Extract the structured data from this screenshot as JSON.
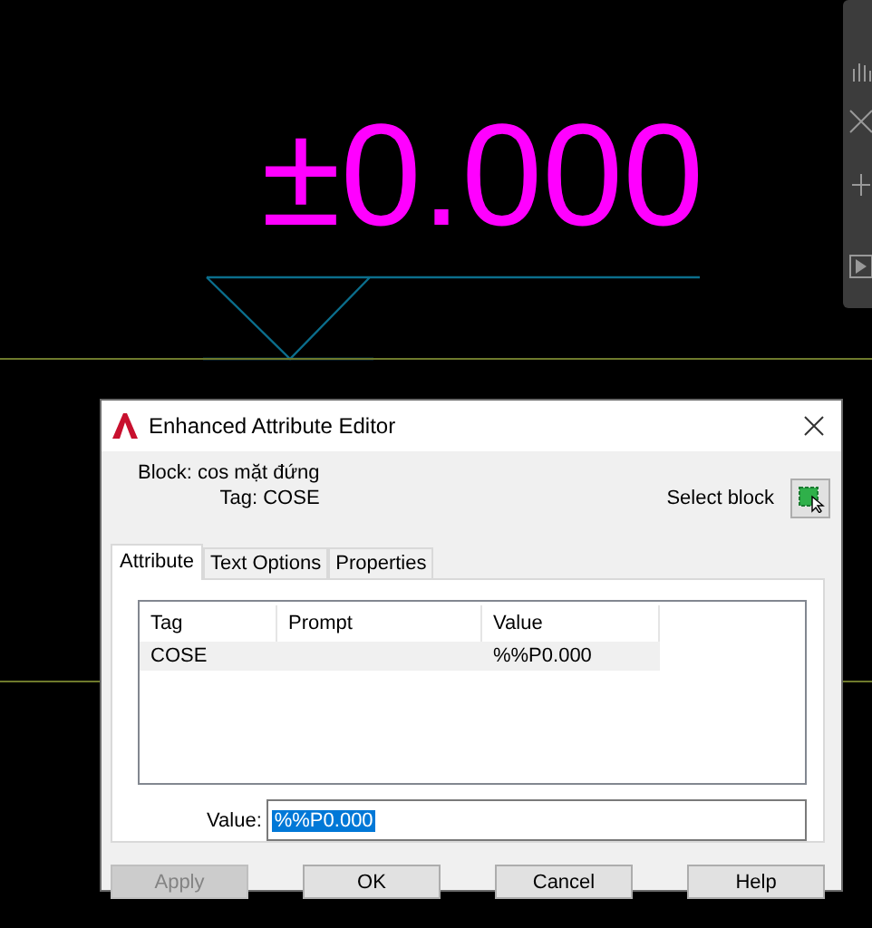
{
  "canvas": {
    "elevation_text": "±0.000"
  },
  "dialog": {
    "title": "Enhanced Attribute Editor",
    "block_label": "Block: cos mặt đứng",
    "tag_label": "Tag: COSE",
    "select_block_label": "Select block",
    "tabs": [
      {
        "label": "Attribute",
        "selected": true
      },
      {
        "label": "Text Options",
        "selected": false
      },
      {
        "label": "Properties",
        "selected": false
      }
    ],
    "table": {
      "columns": [
        "Tag",
        "Prompt",
        "Value"
      ],
      "rows": [
        {
          "cells": [
            "COSE",
            "",
            "%%P0.000"
          ],
          "selected": true
        }
      ]
    },
    "value_field": {
      "label": "Value:",
      "value": "%%P0.000",
      "text_selected": true
    },
    "buttons": [
      {
        "label": "Apply",
        "disabled": true
      },
      {
        "label": "OK",
        "disabled": false
      },
      {
        "label": "Cancel",
        "disabled": false
      },
      {
        "label": "Help",
        "disabled": false
      }
    ]
  }
}
